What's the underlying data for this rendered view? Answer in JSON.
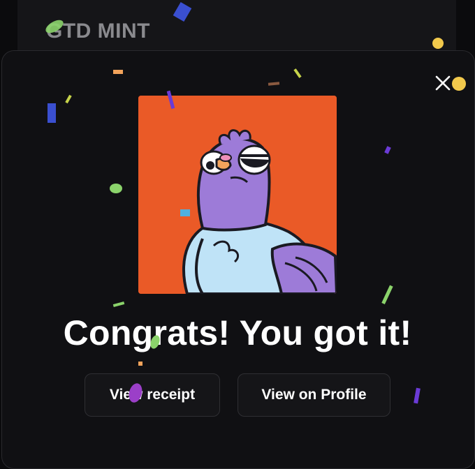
{
  "background": {
    "collection_title": "GTD MINT"
  },
  "modal": {
    "close_icon": "close-icon",
    "artwork": {
      "subject": "purple pigeon illustration",
      "background_color": "#ea5a27"
    },
    "headline": "Congrats! You got it!",
    "buttons": {
      "view_receipt": "View receipt",
      "view_on_profile": "View on Profile"
    }
  },
  "colors": {
    "page_background": "#0b0b0d",
    "modal_background": "#101013",
    "button_background": "#151518",
    "text": "#ffffff"
  }
}
